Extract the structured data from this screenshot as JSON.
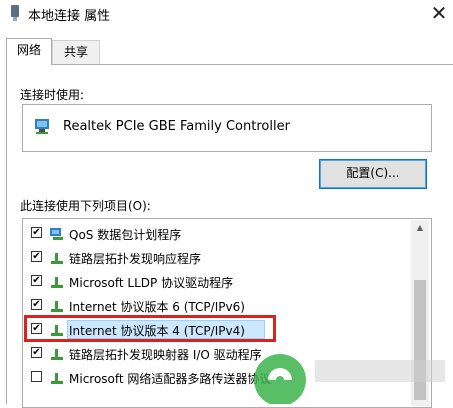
{
  "window": {
    "title": "本地连接 属性",
    "close_glyph": "✕"
  },
  "tabs": [
    {
      "label": "网络"
    },
    {
      "label": "共享"
    }
  ],
  "connect_using": {
    "label": "连接时使用:",
    "adapter_name": "Realtek PCIe GBE Family Controller"
  },
  "configure_button": {
    "label": "配置(C)..."
  },
  "items_section": {
    "label": "此连接使用下列项目(O):",
    "items": [
      {
        "label": "QoS 数据包计划程序",
        "checked": "✔",
        "icon": "qos-network-icon"
      },
      {
        "label": "链路层拓扑发现响应程序",
        "checked": "✔",
        "icon": "network-protocol-icon"
      },
      {
        "label": "Microsoft LLDP 协议驱动程序",
        "checked": "✔",
        "icon": "network-protocol-icon"
      },
      {
        "label": "Internet 协议版本 6 (TCP/IPv6)",
        "checked": "✔",
        "icon": "network-protocol-icon"
      },
      {
        "label": "Internet 协议版本 4 (TCP/IPv4)",
        "checked": "✔",
        "icon": "network-protocol-icon"
      },
      {
        "label": "链路层拓扑发现映射器 I/O 驱动程序",
        "checked": "✔",
        "icon": "network-protocol-icon"
      },
      {
        "label": "Microsoft 网络适配器多路传送器协议",
        "checked": "",
        "icon": "network-protocol-icon"
      }
    ]
  },
  "colors": {
    "selection_bg": "#cce8ff",
    "highlight_frame": "#d9231f",
    "button_border": "#0078d7"
  }
}
